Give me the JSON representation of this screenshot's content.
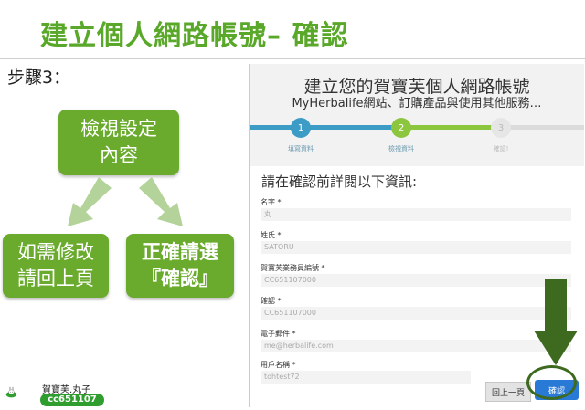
{
  "slide": {
    "title": "建立個人網路帳號– 確認",
    "step": "步驟3：",
    "boxes": {
      "review": "檢視設定\n內容",
      "fix": "如需修改\n請回上頁",
      "confirm": "正確請選\n『確認』"
    }
  },
  "screenshot": {
    "title": "建立您的賀寶芙個人網路帳號",
    "subtitle": "MyHerbalife網站、訂購產品與使用其他服務…",
    "progress": {
      "steps": [
        {
          "number": "1",
          "label": "填寫資料"
        },
        {
          "number": "2",
          "label": "檢視資料"
        },
        {
          "number": "3",
          "label": "確認!"
        }
      ],
      "current_step": 2
    },
    "form_title": "請在確認前詳閱以下資訊:",
    "fields": [
      {
        "label": "名字 *",
        "value": "丸"
      },
      {
        "label": "姓氏 *",
        "value": "SATORU"
      },
      {
        "label": "賀寶芙業務員編號 *",
        "value": "CC651107000"
      },
      {
        "label": "確認 *",
        "value": "CC651107000"
      },
      {
        "label": "電子郵件 *",
        "value": "me@herbalife.com"
      },
      {
        "label": "用戶名稱 *",
        "value": "tohtest72"
      }
    ],
    "buttons": {
      "back": "回上一頁",
      "confirm": "確認"
    }
  },
  "logo": {
    "name": "賀寶芙.丸子",
    "badge": "cc651107"
  },
  "colors": {
    "title_green": "#5aa82a",
    "box_green": "#6aab2e",
    "progress_blue": "#3d9cc5",
    "progress_green": "#8cc63e",
    "confirm_blue": "#2979d6",
    "arrow_dark_green": "#3e6a20"
  }
}
